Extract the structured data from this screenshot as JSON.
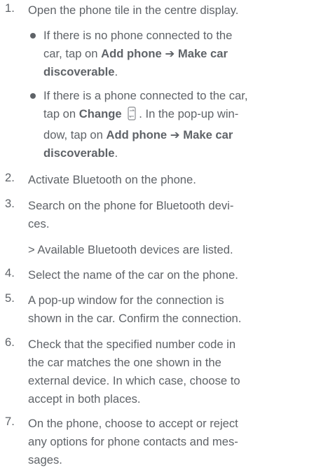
{
  "steps": [
    {
      "num": "1.",
      "lines": [
        "Open the phone tile in the centre display."
      ]
    },
    {
      "num": "2.",
      "lines": [
        "Activate Bluetooth on the phone."
      ]
    },
    {
      "num": "3.",
      "lines": [
        "Search on the phone for Bluetooth devi-",
        "ces."
      ]
    },
    {
      "num": "4.",
      "lines": [
        "Select the name of the car on the phone."
      ]
    },
    {
      "num": "5.",
      "lines": [
        "A pop-up window for the connection is",
        "shown in the car. Confirm the connection."
      ]
    },
    {
      "num": "6.",
      "lines": [
        "Check that the specified number code in",
        "the car matches the one shown in the",
        "external device. In which case, choose to",
        "accept in both places."
      ]
    },
    {
      "num": "7.",
      "lines": [
        "On the phone, choose to accept or reject",
        "any options for phone contacts and mes-",
        "sages."
      ]
    }
  ],
  "bullet1": {
    "line1": "If there is no phone connected to the",
    "line2_prefix": "car, tap on ",
    "add_phone": "Add phone",
    "arrow": "➔",
    "make_car": "Make car",
    "discoverable": "discoverable",
    "period": "."
  },
  "bullet2": {
    "line1": "If there is a phone connected to the car,",
    "line2_prefix": "tap on ",
    "change": "Change",
    "line2_suffix": ". In the pop-up win-",
    "line3_prefix": "dow, tap on ",
    "add_phone": "Add phone",
    "arrow": "➔",
    "make_car": "Make car",
    "discoverable": "discoverable",
    "period": "."
  },
  "result_step3": "> Available Bluetooth devices are listed.",
  "change_icon": "swap-phone-icon"
}
